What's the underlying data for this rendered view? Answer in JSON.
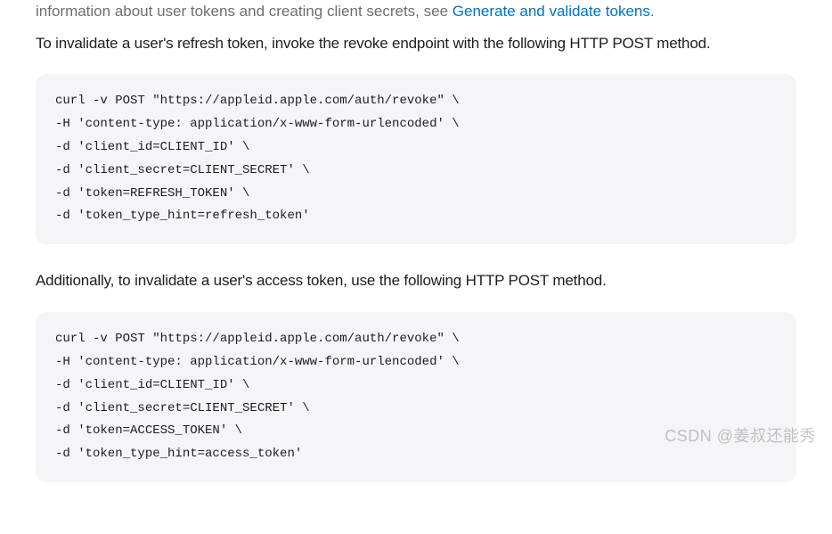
{
  "truncated": {
    "prefix": "information about user tokens and creating client secrets, see ",
    "link": "Generate and validate tokens"
  },
  "paragraph1": "To invalidate a user's refresh token, invoke the revoke endpoint with the following HTTP POST method.",
  "code1": "curl -v POST \"https://appleid.apple.com/auth/revoke\" \\\n-H 'content-type: application/x-www-form-urlencoded' \\\n-d 'client_id=CLIENT_ID' \\\n-d 'client_secret=CLIENT_SECRET' \\\n-d 'token=REFRESH_TOKEN' \\\n-d 'token_type_hint=refresh_token'",
  "paragraph2": "Additionally, to invalidate a user's access token, use the following HTTP POST method.",
  "code2": "curl -v POST \"https://appleid.apple.com/auth/revoke\" \\\n-H 'content-type: application/x-www-form-urlencoded' \\\n-d 'client_id=CLIENT_ID' \\\n-d 'client_secret=CLIENT_SECRET' \\\n-d 'token=ACCESS_TOKEN' \\\n-d 'token_type_hint=access_token'",
  "watermark": "CSDN @姜叔还能秀"
}
